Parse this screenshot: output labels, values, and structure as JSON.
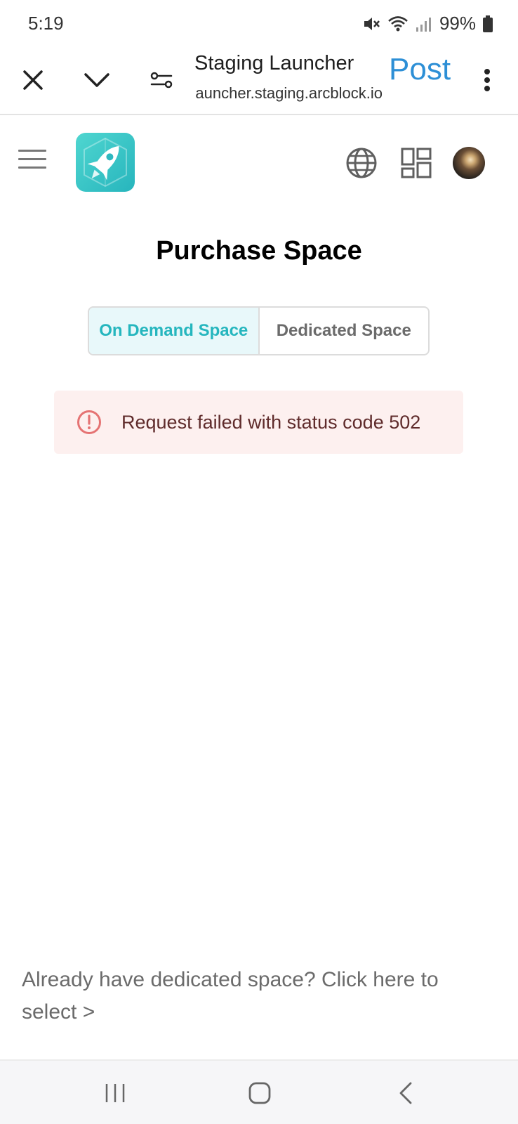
{
  "status_bar": {
    "time": "5:19",
    "battery": "99%",
    "icons": [
      "mute-icon",
      "wifi-icon",
      "signal-icon",
      "battery-icon"
    ]
  },
  "browser": {
    "title": "Staging Launcher",
    "url": "launcher.staging.arcblock.io",
    "post_label": "Post",
    "post_color": "#2d8fd6",
    "icons": [
      "close-icon",
      "chevron-down-icon",
      "site-settings-icon",
      "more-vert-icon"
    ]
  },
  "app_header": {
    "icons": [
      "menu-icon",
      "app-logo-rocket",
      "globe-icon",
      "apps-grid-icon",
      "avatar"
    ]
  },
  "main": {
    "title": "Purchase Space",
    "tabs": [
      {
        "label": "On Demand Space",
        "active": true
      },
      {
        "label": "Dedicated Space",
        "active": false
      }
    ],
    "accent_color": "#25b6be",
    "alert": {
      "message": "Request failed with status code 502",
      "icon": "error-icon",
      "color": "#e57373"
    },
    "dedicated_link": "Already have dedicated space? Click here to select >"
  },
  "nav_bar": {
    "icons": [
      "recent-apps-icon",
      "home-icon",
      "back-icon"
    ]
  }
}
